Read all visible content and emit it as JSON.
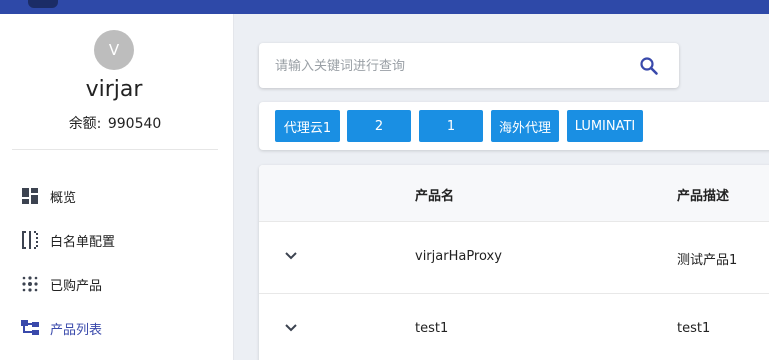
{
  "user": {
    "avatar_initial": "V",
    "name": "virjar",
    "balance_label": "余额:",
    "balance_value": "990540"
  },
  "sidebar": {
    "items": [
      {
        "label": "概览",
        "icon": "dashboard-icon"
      },
      {
        "label": "白名单配置",
        "icon": "whitelist-icon"
      },
      {
        "label": "已购产品",
        "icon": "purchased-products-icon"
      },
      {
        "label": "产品列表",
        "icon": "product-list-icon",
        "active": true
      }
    ]
  },
  "search": {
    "placeholder": "请输入关键词进行查询",
    "value": ""
  },
  "chips": [
    "代理云1",
    "2",
    "1",
    "海外代理",
    "LUMINATI"
  ],
  "table": {
    "columns": [
      "",
      "产品名",
      "产品描述"
    ],
    "rows": [
      {
        "name": "virjarHaProxy",
        "description": "测试产品1"
      },
      {
        "name": "test1",
        "description": "test1"
      }
    ]
  },
  "colors": {
    "topbar": "#2e49a8",
    "accent": "#3949ab",
    "chip": "#1a8fe3",
    "avatar": "#bdbdbd"
  }
}
